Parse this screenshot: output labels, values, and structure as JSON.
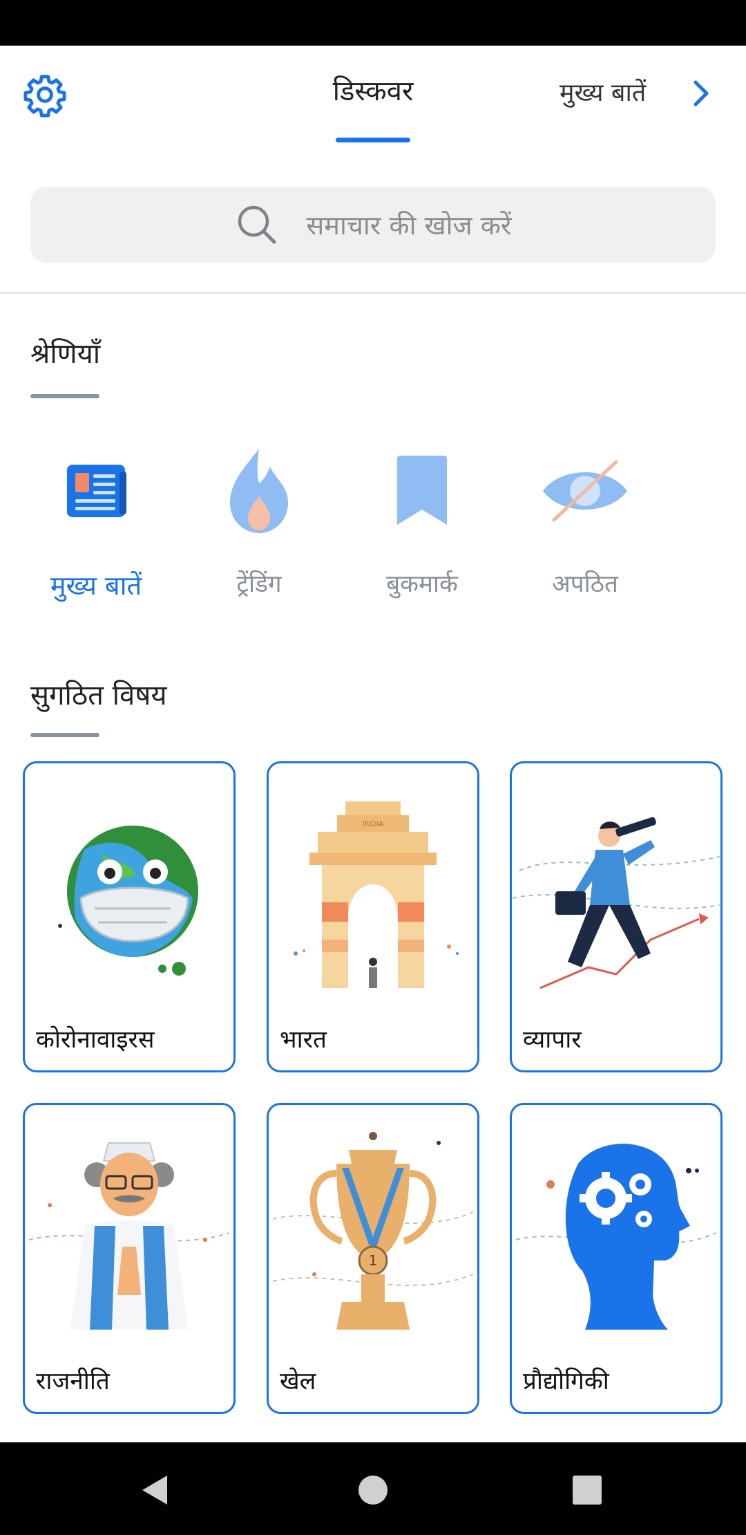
{
  "colors": {
    "accent": "#1a73e8",
    "muted": "#8a8f96"
  },
  "header": {
    "settings_icon": "gear-icon",
    "title": "डिस्कवर",
    "right_link": "मुख्य बातें",
    "right_icon": "chevron-right-icon"
  },
  "search": {
    "placeholder": "समाचार की खोज करें",
    "icon": "search-icon"
  },
  "categories": {
    "title": "श्रेणियाँ",
    "items": [
      {
        "label": "मुख्य बातें",
        "icon": "newspaper-icon",
        "active": true
      },
      {
        "label": "ट्रेंडिंग",
        "icon": "flame-icon",
        "active": false
      },
      {
        "label": "बुकमार्क",
        "icon": "bookmark-icon",
        "active": false
      },
      {
        "label": "अपठित",
        "icon": "eye-off-icon",
        "active": false
      }
    ]
  },
  "topics": {
    "title": "सुगठित विषय",
    "items": [
      {
        "label": "कोरोनावाइरस",
        "art": "masked-earth-illustration"
      },
      {
        "label": "भारत",
        "art": "india-gate-illustration"
      },
      {
        "label": "व्यापार",
        "art": "businessman-telescope-illustration"
      },
      {
        "label": "राजनीति",
        "art": "politician-illustration"
      },
      {
        "label": "खेल",
        "art": "trophy-medal-illustration"
      },
      {
        "label": "प्रौद्योगिकी",
        "art": "head-gears-illustration"
      }
    ],
    "india_gate_text": "INDIA",
    "medal_text": "1"
  },
  "system_nav": {
    "back": "back-icon",
    "home": "home-icon",
    "recents": "recents-icon"
  }
}
